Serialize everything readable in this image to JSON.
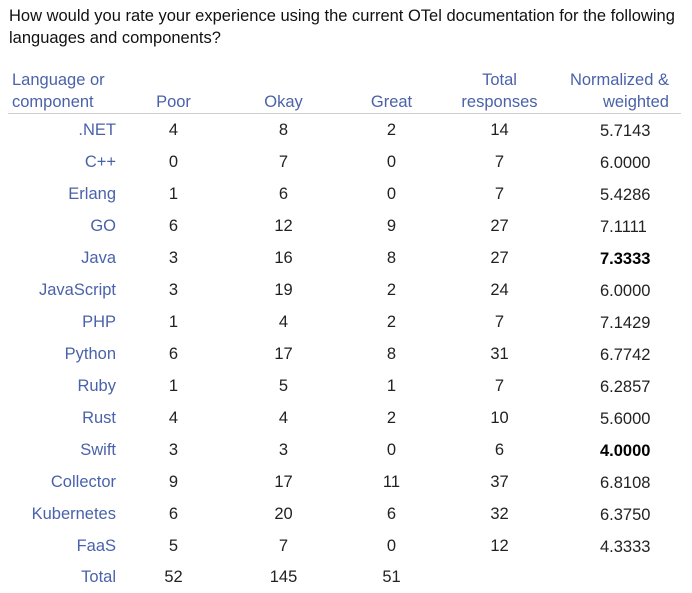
{
  "question": "How would you rate your experience using the current OTel documentation for the following languages and components?",
  "headers": {
    "language_line1": "Language or",
    "language_line2": "component",
    "poor": "Poor",
    "okay": "Okay",
    "great": "Great",
    "total_line1": "Total",
    "total_line2": "responses",
    "norm_line1": "Normalized &",
    "norm_line2": "weighted"
  },
  "rows": [
    {
      "name": ".NET",
      "poor": "4",
      "okay": "8",
      "great": "2",
      "total": "14",
      "norm": "5.7143",
      "bold": false
    },
    {
      "name": "C++",
      "poor": "0",
      "okay": "7",
      "great": "0",
      "total": "7",
      "norm": "6.0000",
      "bold": false
    },
    {
      "name": "Erlang",
      "poor": "1",
      "okay": "6",
      "great": "0",
      "total": "7",
      "norm": "5.4286",
      "bold": false
    },
    {
      "name": "GO",
      "poor": "6",
      "okay": "12",
      "great": "9",
      "total": "27",
      "norm": "7.1111",
      "bold": false
    },
    {
      "name": "Java",
      "poor": "3",
      "okay": "16",
      "great": "8",
      "total": "27",
      "norm": "7.3333",
      "bold": true
    },
    {
      "name": "JavaScript",
      "poor": "3",
      "okay": "19",
      "great": "2",
      "total": "24",
      "norm": "6.0000",
      "bold": false
    },
    {
      "name": "PHP",
      "poor": "1",
      "okay": "4",
      "great": "2",
      "total": "7",
      "norm": "7.1429",
      "bold": false
    },
    {
      "name": "Python",
      "poor": "6",
      "okay": "17",
      "great": "8",
      "total": "31",
      "norm": "6.7742",
      "bold": false
    },
    {
      "name": "Ruby",
      "poor": "1",
      "okay": "5",
      "great": "1",
      "total": "7",
      "norm": "6.2857",
      "bold": false
    },
    {
      "name": "Rust",
      "poor": "4",
      "okay": "4",
      "great": "2",
      "total": "10",
      "norm": "5.6000",
      "bold": false
    },
    {
      "name": "Swift",
      "poor": "3",
      "okay": "3",
      "great": "0",
      "total": "6",
      "norm": "4.0000",
      "bold": true
    },
    {
      "name": "Collector",
      "poor": "9",
      "okay": "17",
      "great": "11",
      "total": "37",
      "norm": "6.8108",
      "bold": false
    },
    {
      "name": "Kubernetes",
      "poor": "6",
      "okay": "20",
      "great": "6",
      "total": "32",
      "norm": "6.3750",
      "bold": false
    },
    {
      "name": "FaaS",
      "poor": "5",
      "okay": "7",
      "great": "0",
      "total": "12",
      "norm": "4.3333",
      "bold": false
    }
  ],
  "total_row": {
    "label": "Total",
    "poor": "52",
    "okay": "145",
    "great": "51"
  }
}
